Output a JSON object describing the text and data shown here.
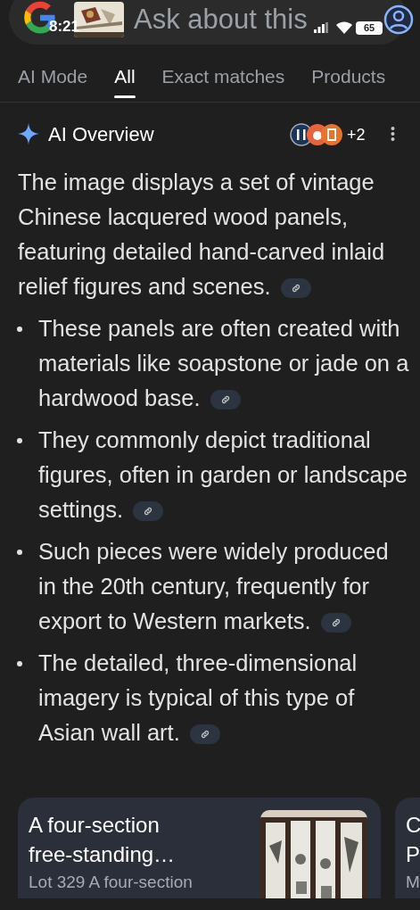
{
  "search_bar": {
    "placeholder": "Ask about this"
  },
  "status_bar": {
    "time": "8:21",
    "battery": "65"
  },
  "tabs": [
    {
      "label": "AI Mode",
      "selected": false
    },
    {
      "label": "All",
      "selected": true
    },
    {
      "label": "Exact matches",
      "selected": false
    },
    {
      "label": "Products",
      "selected": false
    }
  ],
  "ai_overview": {
    "title": "AI Overview",
    "more_sources": "+2",
    "summary": "The image displays a set of vintage Chinese lacquered wood panels, featuring detailed hand-carved inlaid relief figures and scenes.",
    "bullets": [
      "These panels are often created with materials like soapstone or jade on a hardwood base.",
      "They commonly depict traditional figures, often in garden or landscape settings.",
      "Such pieces were widely produced in the 20th century, frequently for export to Western markets.",
      "The detailed, three-dimensional imagery is typical of this type of Asian wall art."
    ]
  },
  "cards": [
    {
      "title_lines": [
        "A four-section",
        "free-standing…"
      ],
      "snippet": "Lot 329 A four-section",
      "kind": "picture"
    },
    {
      "title_lines": [
        "C",
        "P"
      ],
      "snippet": "M"
    }
  ]
}
